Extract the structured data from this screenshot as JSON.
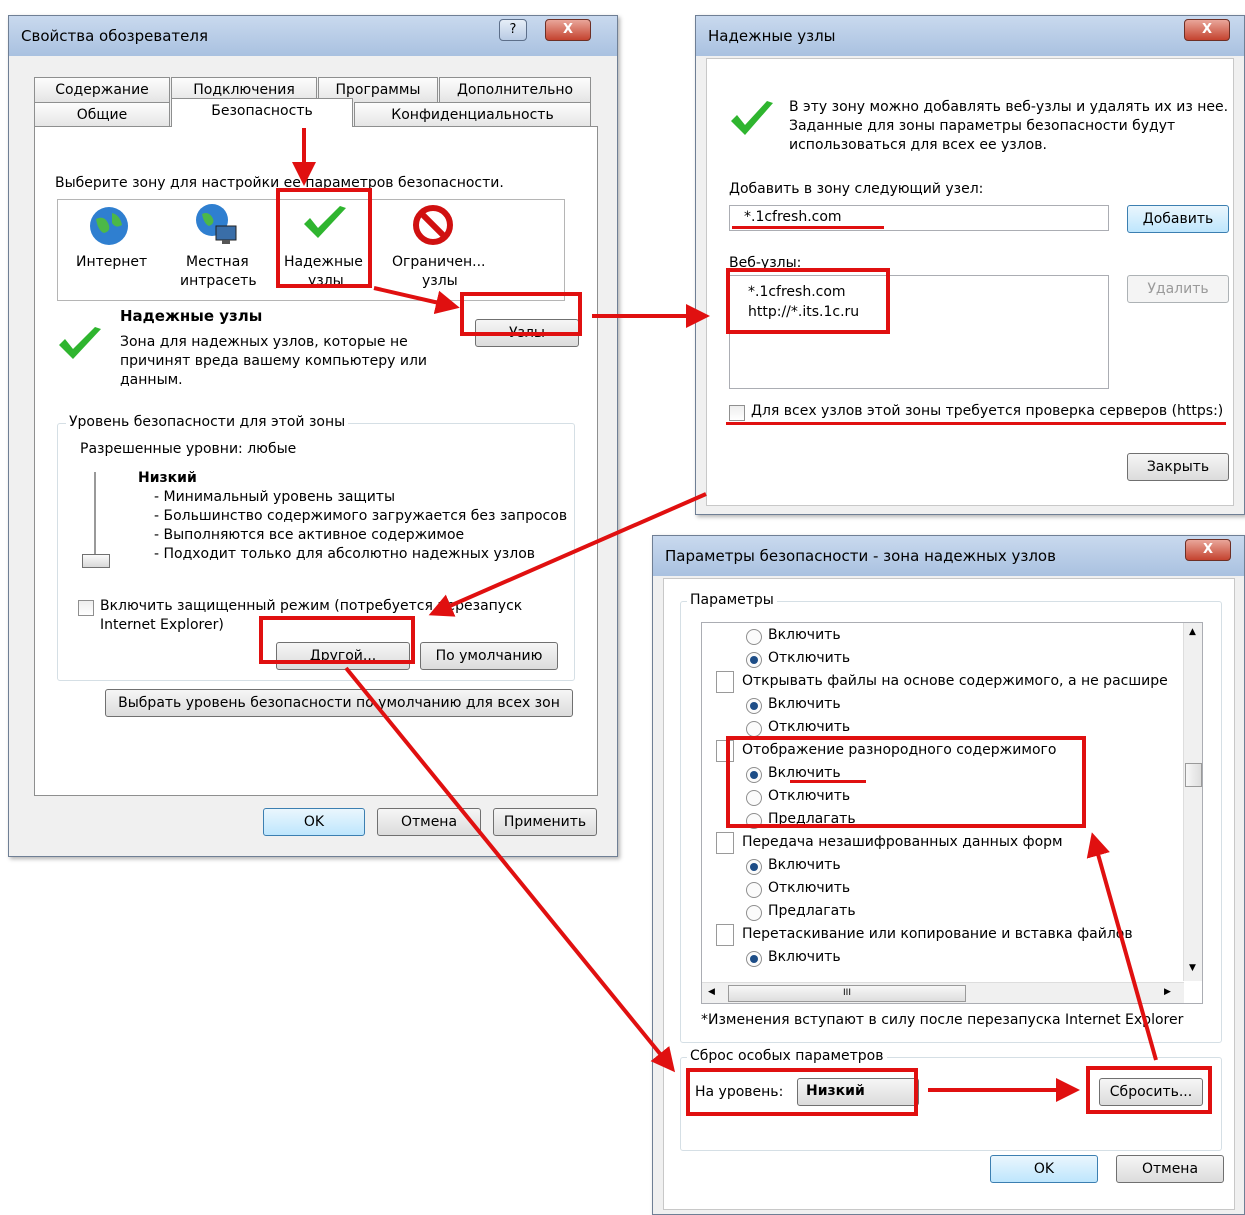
{
  "colors": {
    "accent": "#e01010",
    "check": "#2fb52f",
    "window": "#f0f0f0"
  },
  "w1": {
    "title": "Свойства обозревателя",
    "help": "?",
    "close": "X",
    "tabs_row1": [
      "Содержание",
      "Подключения",
      "Программы",
      "Дополнительно"
    ],
    "tabs_row2": [
      "Общие",
      "Безопасность",
      "Конфиденциальность"
    ],
    "zone_prompt": "Выберите зону для настройки ее параметров безопасности.",
    "zones": [
      {
        "line1": "Интернет",
        "line2": "",
        "icon": "globe-icon"
      },
      {
        "line1": "Местная",
        "line2": "интрасеть",
        "icon": "intranet-icon"
      },
      {
        "line1": "Надежные",
        "line2": "узлы",
        "icon": "checkmark-icon"
      },
      {
        "line1": "Ограничен...",
        "line2": "узлы",
        "icon": "restricted-icon"
      }
    ],
    "zone_title": "Надежные узлы",
    "zone_desc1": "Зона для надежных узлов, которые не",
    "zone_desc2": "причинят вреда вашему компьютеру или",
    "zone_desc3": "данным.",
    "sites_btn": "Узлы",
    "level_legend": "Уровень безопасности для этой зоны",
    "allowed": "Разрешенные уровни: любые",
    "level_name": "Низкий",
    "level_items": [
      "- Минимальный уровень защиты",
      "- Большинство содержимого загружается без запросов",
      "- Выполняются все активное содержимое",
      "- Подходит только для абсолютно надежных узлов"
    ],
    "protected_1": "Включить защищенный режим (потребуется перезапуск",
    "protected_2": "Internet Explorer)",
    "custom_btn": "Другой...",
    "default_btn": "По умолчанию",
    "reset_all_btn": "Выбрать уровень безопасности по умолчанию для всех зон",
    "ok": "OK",
    "cancel": "Отмена",
    "apply": "Применить"
  },
  "w2": {
    "title": "Надежные узлы",
    "close": "X",
    "info1": "В эту зону можно добавлять веб-узлы и удалять их из нее.",
    "info2": "Заданные для зоны параметры безопасности будут",
    "info3": "использоваться для всех ее узлов.",
    "add_label": "Добавить в зону следующий узел:",
    "add_value": "*.1cfresh.com",
    "add_btn": "Добавить",
    "sites_label": "Веб-узлы:",
    "sites": [
      "*.1cfresh.com",
      "http://*.its.1c.ru"
    ],
    "remove_btn": "Удалить",
    "https_label": "Для всех узлов этой зоны требуется проверка серверов (https:)",
    "close_btn": "Закрыть"
  },
  "w3": {
    "title": "Параметры безопасности - зона надежных узлов",
    "close": "X",
    "params_legend": "Параметры",
    "opt_on": "Включить",
    "opt_off": "Отключить",
    "opt_prompt": "Предлагать",
    "set_open": "Открывать файлы на основе содержимого, а не расшире",
    "set_mixed": "Отображение разнородного содержимого",
    "set_forms": "Передача незашифрованных данных форм",
    "set_drag": "Перетаскивание или копирование и вставка файлов",
    "scroll_thumb": "III",
    "note": "*Изменения вступают в силу после перезапуска Internet Explorer",
    "reset_legend": "Сброс особых параметров",
    "level_label": "На уровень:",
    "level_value": "Низкий",
    "reset_btn": "Сбросить...",
    "ok": "OK",
    "cancel": "Отмена"
  }
}
